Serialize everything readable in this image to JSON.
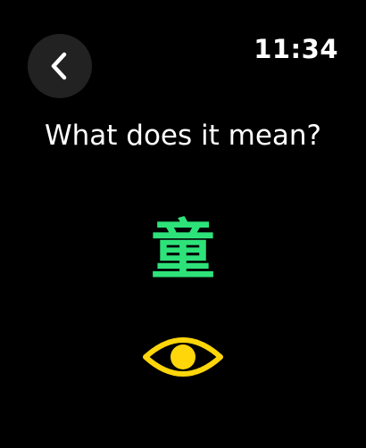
{
  "header": {
    "back_icon": "chevron-left-icon",
    "time": "11:34"
  },
  "quiz": {
    "prompt": "What does it mean?",
    "character": "童",
    "reveal_icon": "eye-icon"
  },
  "colors": {
    "background": "#000000",
    "back_button_bg": "#222222",
    "text": "#ffffff",
    "character": "#2ee27a",
    "eye": "#ffd60a"
  }
}
